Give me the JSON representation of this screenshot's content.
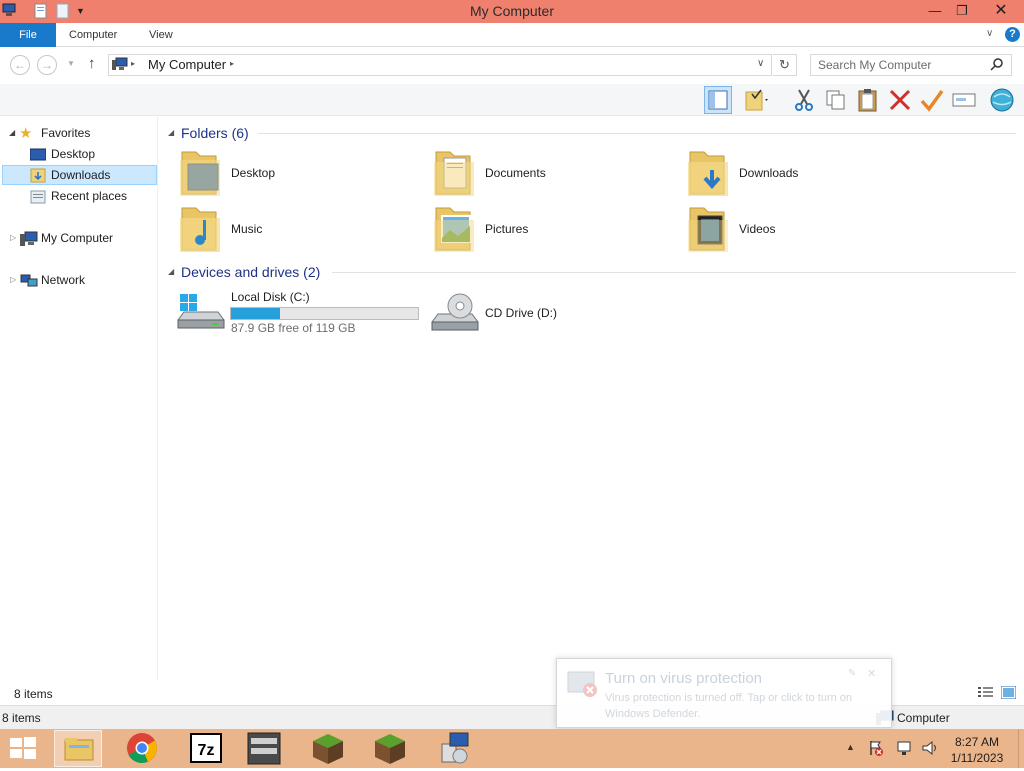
{
  "window": {
    "title": "My Computer"
  },
  "ribbon": {
    "file": "File",
    "tabs": [
      "Computer",
      "View"
    ]
  },
  "address": {
    "location": "My Computer",
    "search_placeholder": "Search My Computer"
  },
  "nav": {
    "favorites": "Favorites",
    "items": [
      "Desktop",
      "Downloads",
      "Recent places"
    ],
    "computer": "My Computer",
    "network": "Network"
  },
  "content": {
    "folders_header": "Folders (6)",
    "folders": [
      "Desktop",
      "Documents",
      "Downloads",
      "Music",
      "Pictures",
      "Videos"
    ],
    "drives_header": "Devices and drives (2)",
    "drives": [
      {
        "name": "Local Disk (C:)",
        "free": "87.9 GB free of 119 GB",
        "used_fraction": 0.26
      },
      {
        "name": "CD Drive (D:)"
      }
    ]
  },
  "status": {
    "items": "8 items",
    "items2": "8 items",
    "location": "Computer"
  },
  "toast": {
    "title": "Turn on virus protection",
    "body": "Virus protection is turned off. Tap or click to turn on Windows Defender."
  },
  "clock": {
    "time": "8:27 AM",
    "date": "1/11/2023"
  },
  "colors": {
    "titlebar": "#f0806e",
    "taskbar": "#ebb58b",
    "accent": "#1979ca",
    "drive_bar": "#26a0da"
  }
}
